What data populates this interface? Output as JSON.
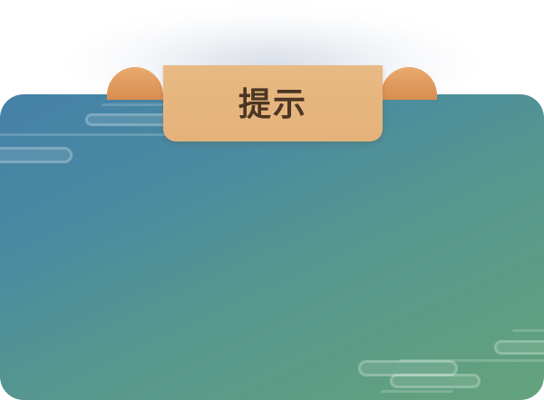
{
  "dialog": {
    "title": "提示"
  },
  "colors": {
    "panel_gradient_start": "#4680a8",
    "panel_gradient_end": "#64a37c",
    "banner": "#e5b27a",
    "banner_roll": "#d98d4f",
    "title_text": "#4b3524"
  },
  "decorations": {
    "icon": "cloud-pattern-icon"
  }
}
